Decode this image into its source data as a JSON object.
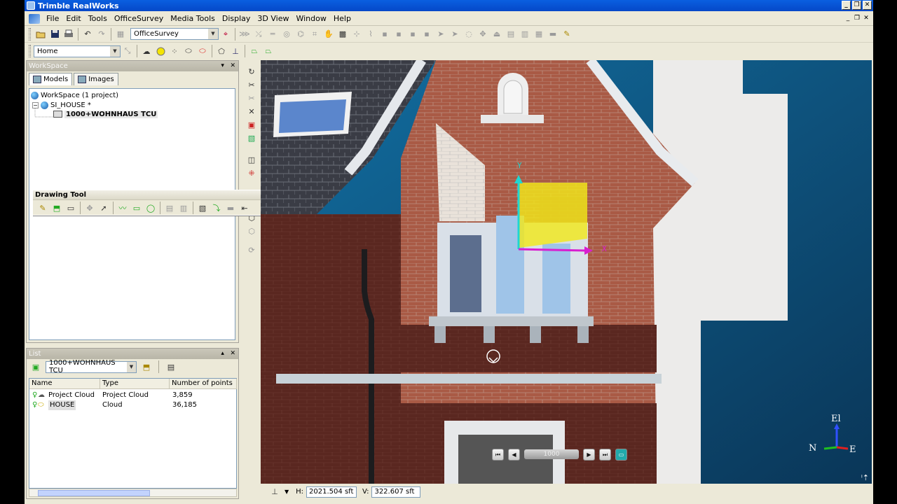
{
  "app_title": "Trimble RealWorks",
  "window_buttons": [
    "_",
    "❐",
    "✕"
  ],
  "menu": [
    "File",
    "Edit",
    "Tools",
    "OfficeSurvey",
    "Media Tools",
    "Display",
    "3D View",
    "Window",
    "Help"
  ],
  "toolbar": {
    "mode_combo": "OfficeSurvey",
    "view_combo": "Home"
  },
  "workspace": {
    "title": "WorkSpace",
    "tabs": [
      "Models",
      "Images"
    ],
    "tree": {
      "root": "WorkSpace (1 project)",
      "project": "SI_HOUSE  *",
      "station": "1000+WOHNHAUS TCU"
    }
  },
  "drawing_tool": {
    "title": "Drawing Tool"
  },
  "list_panel": {
    "title": "List",
    "combo": "1000+WOHNHAUS TCU",
    "columns": [
      "Name",
      "Type",
      "Number of points"
    ],
    "rows": [
      {
        "name": "Project Cloud",
        "type": "Project Cloud",
        "points": "3,859"
      },
      {
        "name": "HOUSE",
        "type": "Cloud",
        "points": "36,185"
      }
    ]
  },
  "viewport": {
    "axis_labels": {
      "up": "El",
      "left": "N",
      "right": "E"
    },
    "gizmo_labels": {
      "y": "Y",
      "x": "X"
    },
    "player_slider": "1000",
    "h_label": "H:",
    "h_value": "2021.504 sft",
    "v_label": "V:",
    "v_value": "322.607 sft"
  },
  "colors": {
    "titlebar": "#0a5fe0",
    "brick": "#a5503d",
    "sky": "#1c6d9b",
    "selection": "#e8d83a",
    "gizmo_y": "#1fd6d2",
    "gizmo_x": "#d81fd0"
  }
}
